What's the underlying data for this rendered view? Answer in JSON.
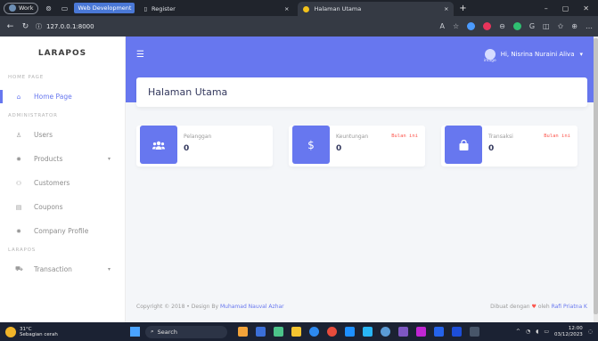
{
  "browser": {
    "profile_label": "Work",
    "workspace_label": "Web Development",
    "tabs": [
      {
        "title": "Register",
        "close": "×"
      },
      {
        "title": "Halaman Utama",
        "close": "×"
      }
    ],
    "new_tab": "+",
    "url": "127.0.0.1:8000"
  },
  "sidebar": {
    "brand": "LARAPOS",
    "sections": [
      {
        "title": "HOME PAGE",
        "items": [
          {
            "label": "Home Page",
            "icon": "home-icon"
          }
        ]
      },
      {
        "title": "ADMINISTRATOR",
        "items": [
          {
            "label": "Users",
            "icon": "user-icon"
          },
          {
            "label": "Products",
            "icon": "gear-icon"
          },
          {
            "label": "Customers",
            "icon": "users-icon"
          },
          {
            "label": "Coupons",
            "icon": "ticket-icon"
          },
          {
            "label": "Company Profile",
            "icon": "gear-icon"
          }
        ]
      },
      {
        "title": "LARAPOS",
        "items": [
          {
            "label": "Transaction",
            "icon": "cart-icon"
          }
        ]
      }
    ]
  },
  "topbar": {
    "user_name": "Hi, Nisrina Nuraini Aliva",
    "avatar_alt": "image"
  },
  "page": {
    "title": "Halaman Utama"
  },
  "cards": [
    {
      "label": "Pelanggan",
      "value": "0",
      "icon": "users-icon"
    },
    {
      "label": "Keuntungan",
      "value": "0",
      "tag": "Bulan ini",
      "icon": "dollar-icon"
    },
    {
      "label": "Transaksi",
      "value": "0",
      "tag": "Bulan ini",
      "icon": "bag-icon"
    }
  ],
  "footer": {
    "left_prefix": "Copyright © 2018 • Design By",
    "left_link": "Muhamad Nauval Azhar",
    "right_prefix": "Dibuat dengan",
    "right_middle": "oleh",
    "right_link": "Rafi Priatna K"
  },
  "taskbar": {
    "temperature": "31°C",
    "weather": "Sebagian cerah",
    "search": "Search",
    "time": "12:00",
    "date": "03/12/2023"
  },
  "colors": {
    "primary": "#6777ef",
    "danger": "#fc544b",
    "background": "#f4f6f9"
  }
}
